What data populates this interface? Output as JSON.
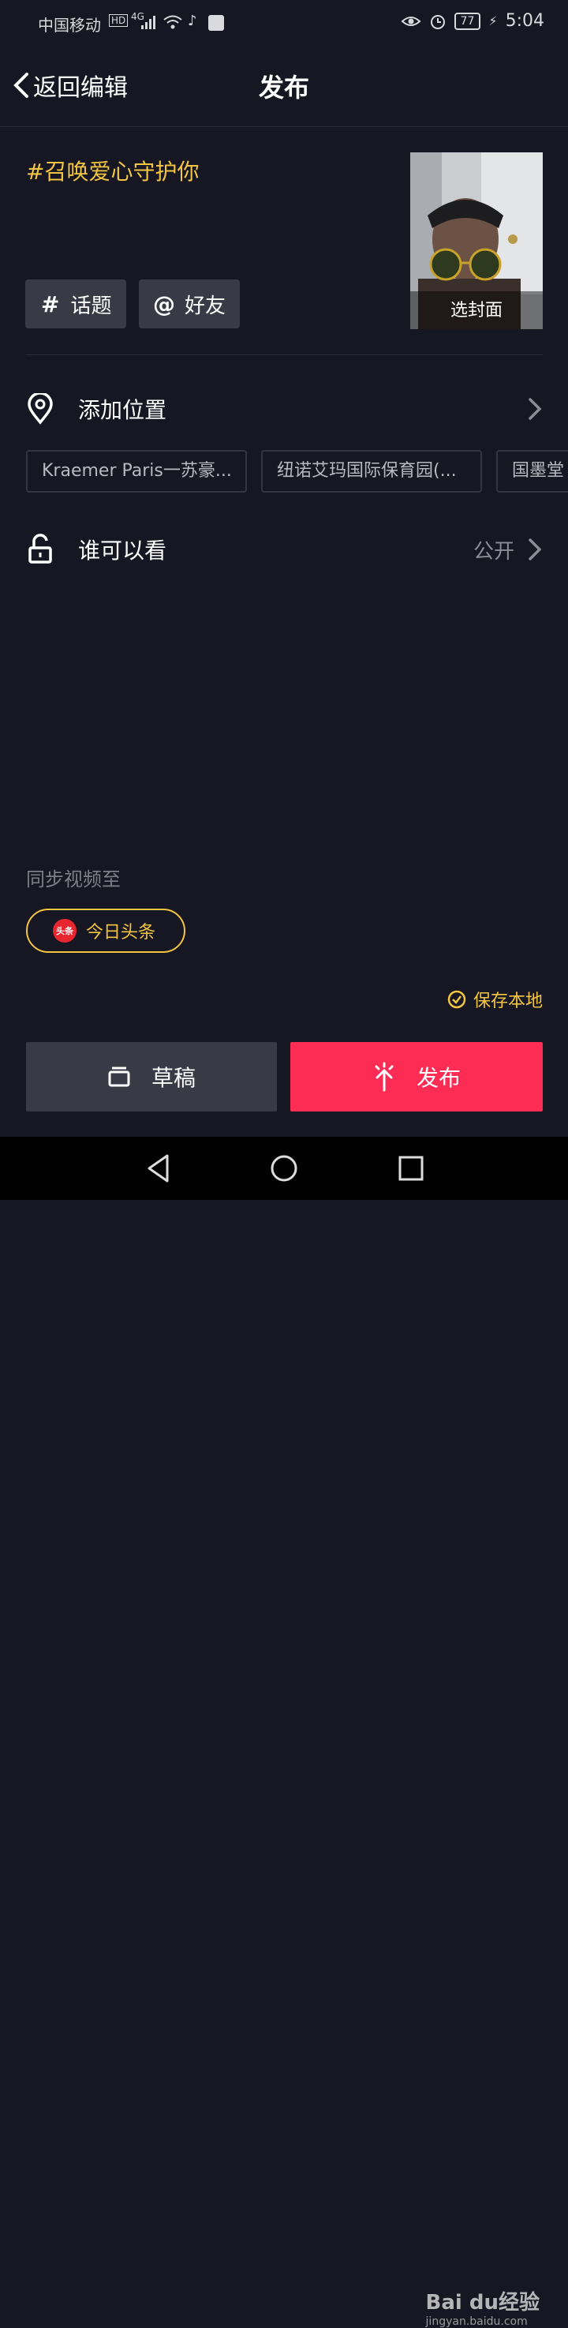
{
  "status_bar": {
    "carrier": "中国移动",
    "network": "4G",
    "battery": "77",
    "time": "5:04"
  },
  "header": {
    "back_label": "返回编辑",
    "title": "发布"
  },
  "post": {
    "caption": "#召唤爱心守护你",
    "topic_button": "话题",
    "friend_button": "好友",
    "cover_label": "选封面"
  },
  "location": {
    "label": "添加位置",
    "suggestions": [
      "Kraemer Paris一苏豪...",
      "纽诺艾玛国际保育园(...",
      "国墨堂"
    ]
  },
  "visibility": {
    "label": "谁可以看",
    "value": "公开"
  },
  "sync": {
    "label": "同步视频至",
    "toutiao_icon_text": "头条",
    "toutiao_label": "今日头条"
  },
  "save_local": {
    "label": "保存本地"
  },
  "actions": {
    "draft_label": "草稿",
    "publish_label": "发布"
  },
  "watermark": {
    "line1": "Bai du经验",
    "line2": "jingyan.baidu.com"
  },
  "colors": {
    "background": "#161722",
    "accent_yellow": "#f3c542",
    "publish_red": "#fd2c55",
    "chip_gray": "#393a45"
  }
}
